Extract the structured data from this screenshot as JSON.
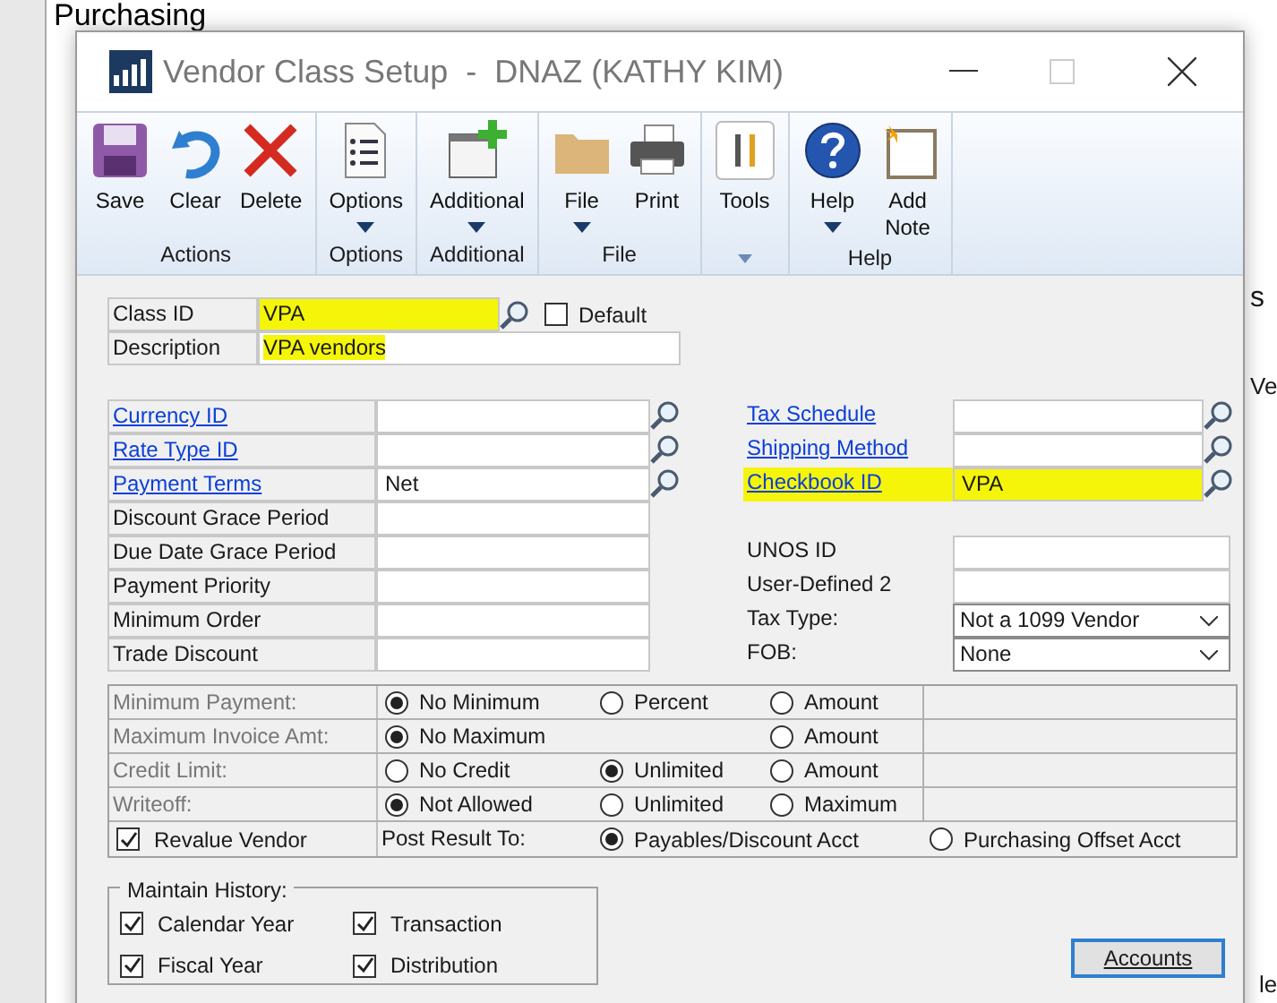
{
  "background_window": {
    "title": "Purchasing",
    "edge_texts": [
      "s",
      "Ve",
      "le"
    ]
  },
  "window": {
    "title": "Vendor Class Setup  -  DNAZ (KATHY KIM)",
    "maximize_disabled": true
  },
  "ribbon": [
    {
      "label": "Actions",
      "buttons": [
        {
          "label": "Save",
          "kind": "save",
          "dropdown": false
        },
        {
          "label": "Clear",
          "kind": "undo",
          "dropdown": false
        },
        {
          "label": "Delete",
          "kind": "delete",
          "dropdown": false
        }
      ]
    },
    {
      "label": "Options",
      "buttons": [
        {
          "label": "Options",
          "kind": "list",
          "dropdown": true
        }
      ]
    },
    {
      "label": "Additional",
      "buttons": [
        {
          "label": "Additional",
          "kind": "window",
          "dropdown": true
        }
      ]
    },
    {
      "label": "File",
      "buttons": [
        {
          "label": "File",
          "kind": "folder",
          "dropdown": true
        },
        {
          "label": "Print",
          "kind": "printer",
          "dropdown": false
        }
      ]
    },
    {
      "buttons": [
        {
          "label": "Tools",
          "kind": "tools",
          "dropdown": false
        }
      ]
    },
    {
      "label": "Help",
      "buttons": [
        {
          "label": "Help",
          "kind": "help",
          "dropdown": true
        },
        {
          "label": "Add\nNote",
          "kind": "note",
          "dropdown": false
        }
      ]
    }
  ],
  "header": {
    "class_id": {
      "label": "Class ID",
      "value": "VPA",
      "highlighted": true
    },
    "default": {
      "label": "Default",
      "checked": false
    },
    "description": {
      "label": "Description",
      "value": "VPA vendors",
      "highlighted": true
    }
  },
  "left_fields": [
    {
      "label": "Currency ID",
      "link": true,
      "lookup": true
    },
    {
      "label": "Rate Type ID",
      "link": true,
      "lookup": true
    },
    {
      "label": "Payment Terms",
      "link": true,
      "value": "Net",
      "lookup": true
    },
    {
      "label": "Discount Grace Period",
      "link": false,
      "lookup": false
    },
    {
      "label": "Due Date Grace Period",
      "link": false,
      "lookup": false
    },
    {
      "label": "Payment Priority",
      "link": false,
      "lookup": false
    },
    {
      "label": "Minimum Order",
      "link": false,
      "lookup": false
    },
    {
      "label": "Trade Discount",
      "link": false,
      "lookup": false
    }
  ],
  "right_lookups": [
    {
      "label": "Tax Schedule",
      "highlighted": false
    },
    {
      "label": "Shipping Method",
      "highlighted": false
    },
    {
      "label": "Checkbook ID",
      "value": "VPA",
      "highlighted": true
    }
  ],
  "right_fields": [
    {
      "kind": "text",
      "label": "UNOS ID"
    },
    {
      "kind": "text",
      "label": "User-Defined 2"
    },
    {
      "kind": "dropdown",
      "label": "Tax Type:",
      "value": "Not a 1099 Vendor"
    },
    {
      "kind": "dropdown",
      "label": "FOB:",
      "value": "None"
    }
  ],
  "radio_rows": [
    {
      "label": "Minimum Payment:",
      "options": [
        {
          "label": "No Minimum",
          "selected": true
        },
        {
          "label": "Percent",
          "selected": false
        },
        {
          "label": "Amount",
          "selected": false
        }
      ]
    },
    {
      "label": "Maximum Invoice Amt:",
      "options": [
        {
          "label": "No Maximum",
          "selected": true
        },
        {
          "label": "Amount",
          "selected": false
        }
      ]
    },
    {
      "label": "Credit Limit:",
      "options": [
        {
          "label": "No Credit",
          "selected": false
        },
        {
          "label": "Unlimited",
          "selected": true
        },
        {
          "label": "Amount",
          "selected": false
        }
      ]
    },
    {
      "label": "Writeoff:",
      "options": [
        {
          "label": "Not Allowed",
          "selected": true
        },
        {
          "label": "Unlimited",
          "selected": false
        },
        {
          "label": "Maximum",
          "selected": false
        }
      ]
    }
  ],
  "revalue": {
    "label": "Revalue Vendor",
    "checked": true,
    "post_label": "Post Result To:",
    "options": [
      {
        "label": "Payables/Discount Acct",
        "selected": true
      },
      {
        "label": "Purchasing Offset Acct",
        "selected": false
      }
    ]
  },
  "history": {
    "title": "Maintain History:",
    "items": [
      {
        "label": "Calendar Year",
        "checked": true
      },
      {
        "label": "Transaction",
        "checked": true
      },
      {
        "label": "Fiscal Year",
        "checked": true
      },
      {
        "label": "Distribution",
        "checked": true
      }
    ]
  },
  "accounts_button": "Accounts"
}
